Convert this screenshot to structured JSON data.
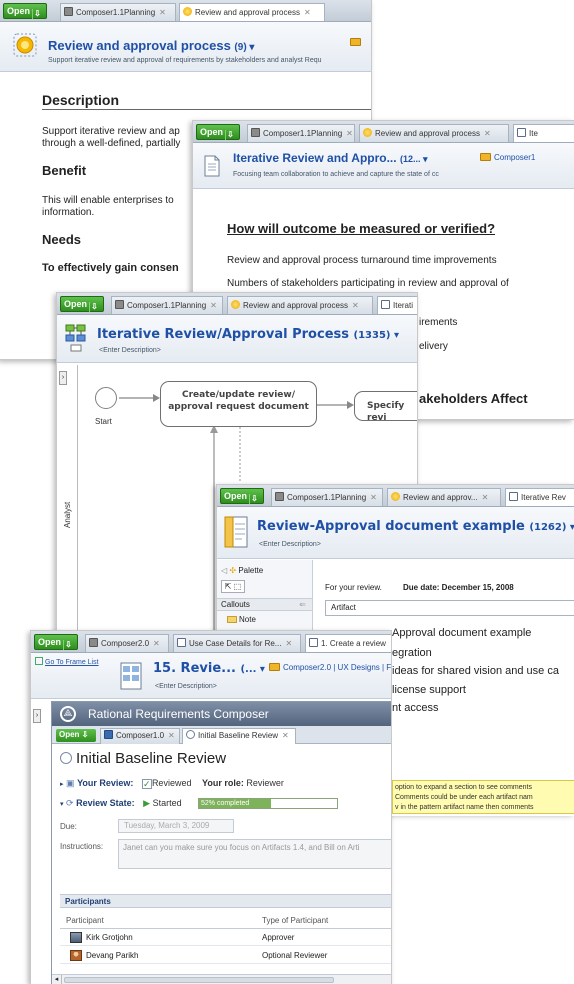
{
  "p1": {
    "open": "Open",
    "tab1": "Composer1.1Planning",
    "tab2": "Review and approval process",
    "title": "Review and approval process",
    "count": "(9) ▾",
    "subtitle": "Support iterative review and approval of requirements by stakeholders and analyst Requ",
    "h_desc": "Description",
    "desc1": "Support iterative review and ap",
    "desc2": "through a well-defined, partially",
    "h_benefit": "Benefit",
    "ben1": "This will enable enterprises to",
    "ben2": "information.",
    "h_needs": "Needs",
    "needs_bold": "To effectively gain consen"
  },
  "p2": {
    "open": "Open",
    "tab1": "Composer1.1Planning",
    "tab2": "Review and approval process",
    "tab3": "Ite",
    "title": "Iterative Review and Appro...",
    "count": "(12... ▾",
    "folder": "Composer1",
    "subtitle": "Focusing team collaboration to achieve and capture the state of cc",
    "h_measure": "How will outcome be measured or verified?",
    "m1": "Review and approval process turnaround time improvements",
    "m2": "Numbers of stakeholders participating in review and approval of",
    "m3": "irements",
    "m4": "elivery",
    "h_stake": "akeholders Affect"
  },
  "p3": {
    "open": "Open",
    "tab1": "Composer1.1Planning",
    "tab2": "Review and approval process",
    "tab3": "Iterati",
    "title": "Iterative Review/Approval Process",
    "count": "(1335) ▾",
    "subtitle": "<Enter Description>",
    "start": "Start",
    "node1": "Create/update review/ approval request document",
    "node2": "Specify revi",
    "lane": "Analyst"
  },
  "p4": {
    "open": "Open",
    "tab1": "Composer1.1Planning",
    "tab2": "Review and approv...",
    "tab3": "Iterative Rev",
    "title": "Review-Approval document example",
    "count": "(1262) ▾",
    "subtitle": "<Enter Description>",
    "palette": "Palette",
    "callouts": "Callouts",
    "note": "Note",
    "for_review": "For your review.",
    "due_label": "Due date: December 15, 2008",
    "artifact": "Artifact",
    "l1": "Approval document example",
    "l2": "egration",
    "l3": "ideas for shared vision and use ca",
    "l4": "license support",
    "l5": "nt access",
    "note1": "option to expand a section to see comments",
    "note2": "Comments could be under each artifact nam",
    "note3": "v in the pattern artifact name then comments"
  },
  "p5": {
    "open": "Open",
    "tab1": "Composer2.0",
    "tab2": "Use Case Details for Re...",
    "tab3": "1. Create a review",
    "goto": "Go To Frame List",
    "title": "15. Revie...",
    "count": "(... ▾",
    "folder": "Composer2.0 | UX Designs | F",
    "subtitle": "<Enter Description>",
    "app": "Rational Requirements Composer",
    "open2": "Open",
    "itab1": "Composer1.0",
    "itab2": "Initial Baseline Review",
    "review_title": "Initial Baseline Review",
    "your_review": "Your Review:",
    "reviewed": "Reviewed",
    "your_role": "Your role:",
    "reviewer": "Reviewer",
    "review_state": "Review State:",
    "started": "Started",
    "progress_text": "52% completed",
    "progress": 52,
    "due_label": "Due:",
    "due_value": "Tuesday, March 3, 2009",
    "instr_label": "Instructions:",
    "instr_value": "Janet can you make sure you focus on Artifacts 1.4, and Bill on Arti",
    "participants": "Participants",
    "col1": "Participant",
    "col2": "Type of Participant",
    "rows": [
      {
        "name": "Kirk Grotjohn",
        "type": "Approver"
      },
      {
        "name": "Devang Parikh",
        "type": "Optional Reviewer"
      }
    ]
  }
}
